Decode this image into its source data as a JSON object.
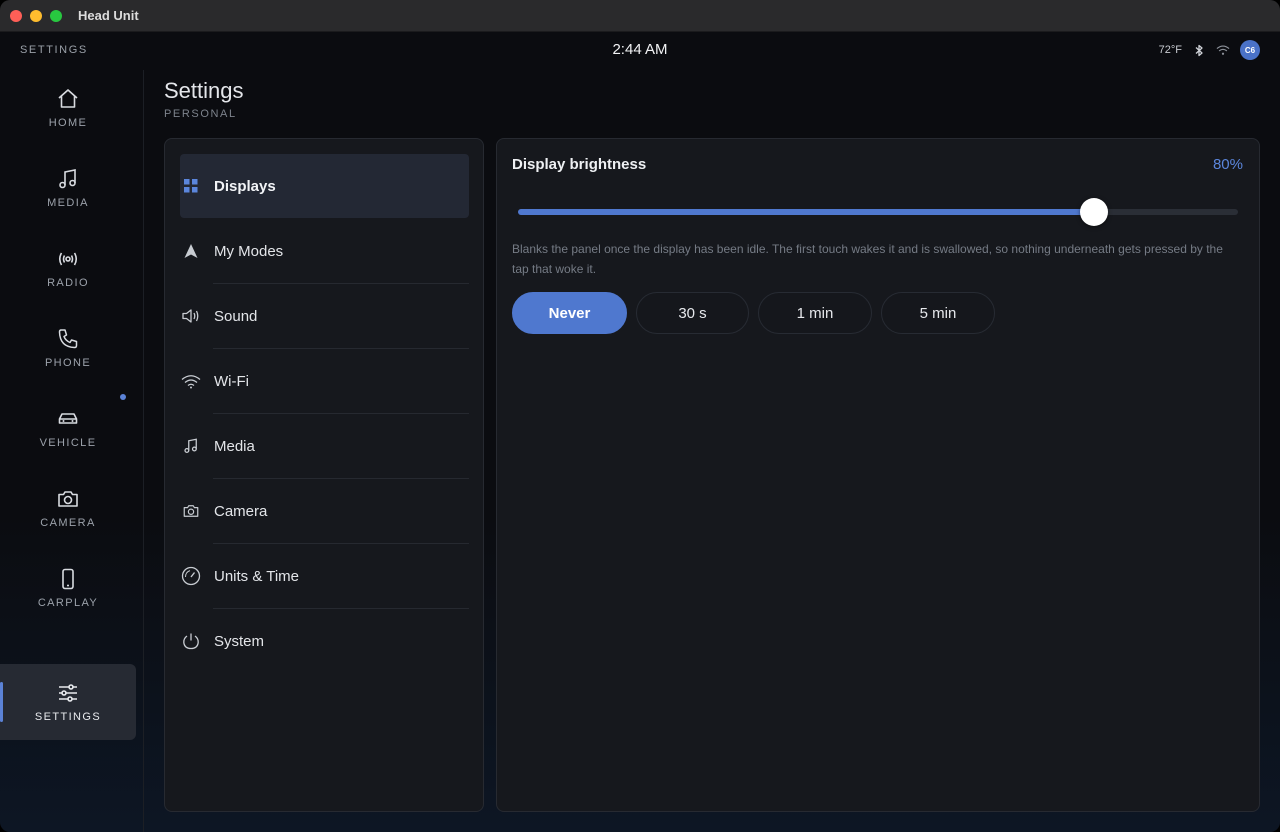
{
  "window": {
    "title": "Head Unit"
  },
  "status": {
    "section": "SETTINGS",
    "clock": "2:44 AM",
    "temperature": "72°F",
    "avatar_initials": "C6",
    "icons": [
      "bluetooth-icon",
      "wifi-icon"
    ]
  },
  "rail": {
    "items": [
      {
        "label": "HOME",
        "icon": "home-icon"
      },
      {
        "label": "MEDIA",
        "icon": "music-note-icon"
      },
      {
        "label": "RADIO",
        "icon": "radio-broadcast-icon"
      },
      {
        "label": "PHONE",
        "icon": "phone-icon"
      },
      {
        "label": "VEHICLE",
        "icon": "car-icon",
        "notification_dot": true
      },
      {
        "label": "CAMERA",
        "icon": "camera-icon"
      },
      {
        "label": "CARPLAY",
        "icon": "smartphone-icon"
      },
      {
        "label": "SETTINGS",
        "icon": "sliders-icon",
        "active": true
      }
    ]
  },
  "page": {
    "title": "Settings",
    "subtitle": "PERSONAL"
  },
  "nav": {
    "items": [
      {
        "label": "Displays",
        "icon": "grid-icon",
        "active": true
      },
      {
        "label": "My Modes",
        "icon": "navigation-arrow-icon"
      },
      {
        "label": "Sound",
        "icon": "speaker-icon"
      },
      {
        "label": "Wi-Fi",
        "icon": "wifi-icon"
      },
      {
        "label": "Media",
        "icon": "music-note-icon"
      },
      {
        "label": "Camera",
        "icon": "camera-icon"
      },
      {
        "label": "Units & Time",
        "icon": "gauge-icon"
      },
      {
        "label": "System",
        "icon": "power-icon"
      }
    ]
  },
  "display": {
    "brightness_label": "Display brightness",
    "brightness_value": "80%",
    "brightness_level": 0.8,
    "description": "Blanks the panel once the display has been idle. The first touch wakes it and is swallowed, so nothing underneath gets pressed by the tap that woke it.",
    "timeout_options": [
      "Never",
      "30 s",
      "1 min",
      "5 min"
    ],
    "timeout_selected": "Never"
  },
  "colors": {
    "accent": "#4f78cf",
    "accent_text": "#5b86dc",
    "card_bg": "#16181d",
    "app_bg": "#0b0c10"
  }
}
